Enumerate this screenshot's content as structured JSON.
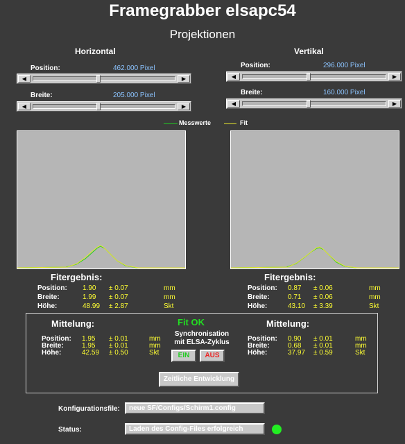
{
  "header": {
    "title": "Framegrabber elsapc54",
    "subtitle": "Projektionen"
  },
  "horizontal": {
    "heading": "Horizontal",
    "position_label": "Position:",
    "position_value": "462.000 Pixel",
    "position_fraction": 0.46,
    "width_label": "Breite:",
    "width_value": "205.000 Pixel",
    "width_fraction": 0.46
  },
  "vertical": {
    "heading": "Vertikal",
    "position_label": "Position:",
    "position_value": "296.000 Pixel",
    "position_fraction": 0.46,
    "width_label": "Breite:",
    "width_value": "160.000 Pixel",
    "width_fraction": 0.46
  },
  "legend": {
    "measured": "Messwerte",
    "fit": "Fit",
    "measured_color": "#22cc22",
    "fit_color": "#e6e62e"
  },
  "fit_results": {
    "heading": "Fitergebnis:",
    "left": [
      {
        "label": "Position:",
        "value": "1.90",
        "error": "± 0.07",
        "unit": "mm"
      },
      {
        "label": "Breite:",
        "value": "1.99",
        "error": "± 0.07",
        "unit": "mm"
      },
      {
        "label": "Höhe:",
        "value": "48.99",
        "error": "± 2.87",
        "unit": "Skt"
      }
    ],
    "right": [
      {
        "label": "Position:",
        "value": "0.87",
        "error": "± 0.06",
        "unit": "mm"
      },
      {
        "label": "Breite:",
        "value": "0.71",
        "error": "± 0.06",
        "unit": "mm"
      },
      {
        "label": "Höhe:",
        "value": "43.10",
        "error": "± 3.39",
        "unit": "Skt"
      }
    ]
  },
  "averaging": {
    "heading": "Mittelung:",
    "fit_status": "Fit OK",
    "fit_status_color": "#22dd22",
    "sync_line1": "Synchronisation",
    "sync_line2": "mit ELSA-Zyklus",
    "on_label": "EIN",
    "off_label": "AUS",
    "on_color": "#22cc22",
    "off_color": "#ee2222",
    "history_button": "Zeitliche Entwicklung",
    "left": [
      {
        "label": "Position:",
        "value": "1.95",
        "error": "± 0.01",
        "unit": "mm"
      },
      {
        "label": "Breite:",
        "value": "1.95",
        "error": "± 0.01",
        "unit": "mm"
      },
      {
        "label": "Höhe:",
        "value": "42.59",
        "error": "± 0.50",
        "unit": "Skt"
      }
    ],
    "right": [
      {
        "label": "Position:",
        "value": "0.90",
        "error": "± 0.01",
        "unit": "mm"
      },
      {
        "label": "Breite:",
        "value": "0.68",
        "error": "± 0.01",
        "unit": "mm"
      },
      {
        "label": "Höhe:",
        "value": "37.97",
        "error": "± 0.59",
        "unit": "Skt"
      }
    ]
  },
  "footer": {
    "config_label": "Konfigurationsfile:",
    "config_value": "neue SF/Configs/Schirm1.config",
    "status_label": "Status:",
    "status_value": "Laden des Config-Files erfolgreich",
    "status_led_color": "#22ee22"
  }
}
